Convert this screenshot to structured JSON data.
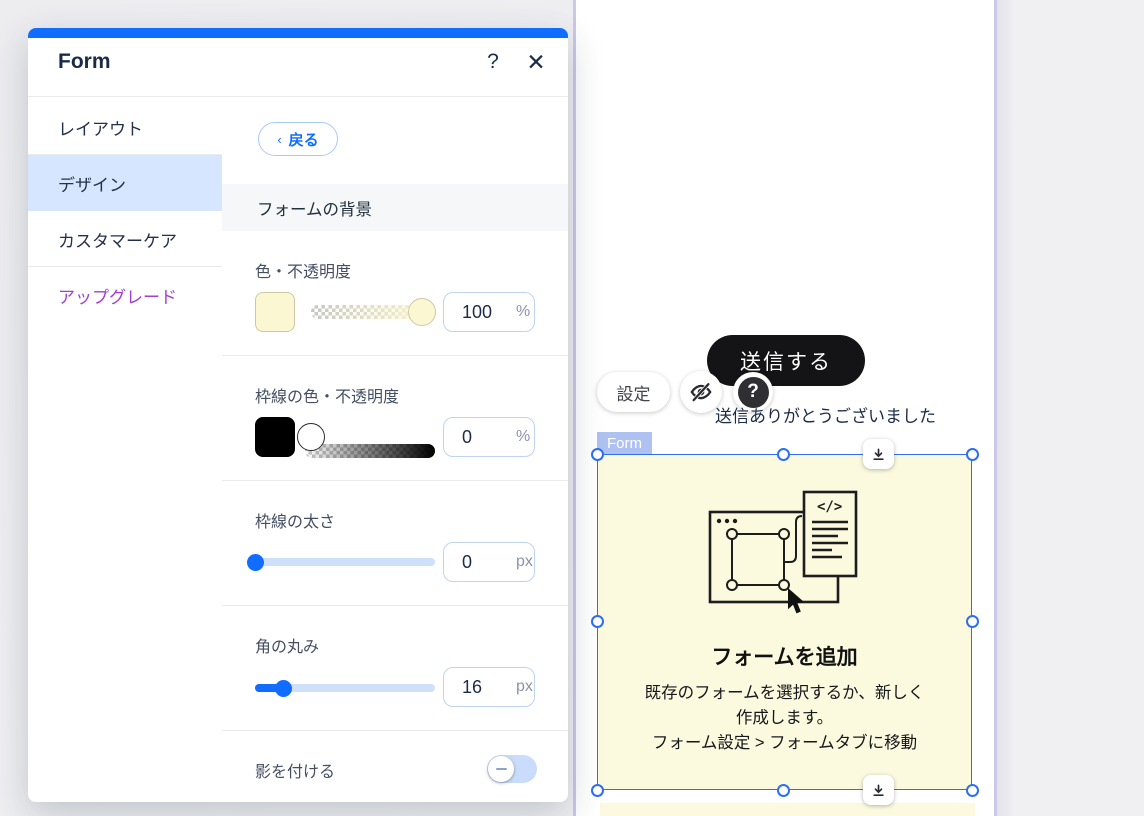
{
  "panel": {
    "title": "Form",
    "icons": {
      "help": "?",
      "close": "✕",
      "back_chevron": "‹"
    },
    "sidebar": {
      "items": [
        {
          "label": "レイアウト",
          "selected": false
        },
        {
          "label": "デザイン",
          "selected": true
        },
        {
          "label": "カスタマーケア",
          "selected": false
        },
        {
          "label": "アップグレード",
          "selected": false,
          "accent": "#A13ED4"
        }
      ]
    },
    "back_label": "戻る",
    "section_header": "フォームの背景",
    "controls": {
      "fill": {
        "label": "色・不透明度",
        "value": "100",
        "unit": "%",
        "swatch_color": "#FAF7D2"
      },
      "border": {
        "label": "枠線の色・不透明度",
        "value": "0",
        "unit": "%",
        "swatch_color": "#000000"
      },
      "border_width": {
        "label": "枠線の太さ",
        "value": "0",
        "unit": "px"
      },
      "corner_radius": {
        "label": "角の丸み",
        "value": "16",
        "unit": "px"
      },
      "shadow": {
        "label": "影を付ける",
        "enabled": false
      }
    }
  },
  "canvas": {
    "submit_label": "送信する",
    "settings_label": "設定",
    "question_glyph": "?",
    "thank_you": "送信ありがとうございました",
    "element_tag": "Form",
    "placeholder": {
      "title": "フォームを追加",
      "line1": "既存のフォームを選択するか、新しく",
      "line2": "作成します。",
      "line3": "フォーム設定 > フォームタブに移動",
      "code_glyph": "</>"
    }
  },
  "colors": {
    "accent_blue": "#116DFF",
    "upgrade_purple": "#A13ED4",
    "selection_blue": "#2E6FF2",
    "form_background": "#FBF9DE",
    "page_guide": "#CBC8E9"
  }
}
